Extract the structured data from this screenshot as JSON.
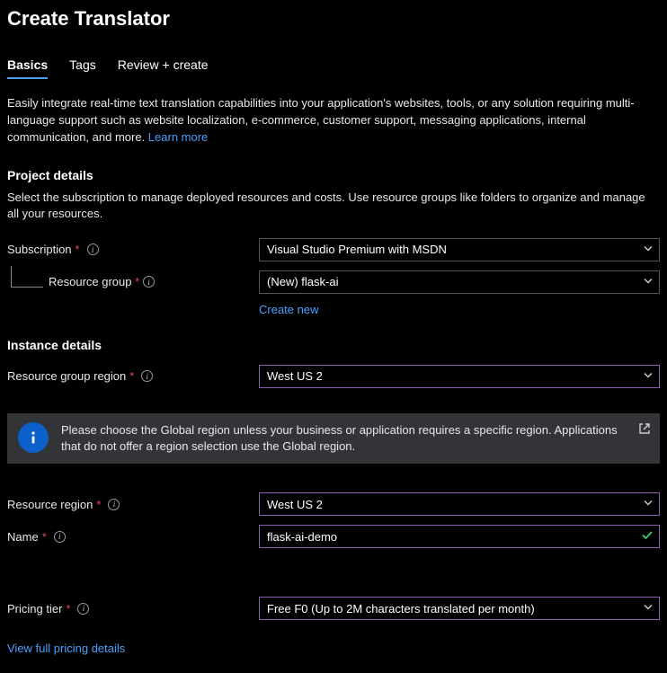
{
  "page_title": "Create Translator",
  "tabs": {
    "basics": "Basics",
    "tags": "Tags",
    "review": "Review + create"
  },
  "intro_text": "Easily integrate real-time text translation capabilities into your application's websites, tools, or any solution requiring multi-language support such as website localization, e-commerce, customer support, messaging applications, internal communication, and more. ",
  "learn_more": "Learn more",
  "project_details": {
    "title": "Project details",
    "desc": "Select the subscription to manage deployed resources and costs. Use resource groups like folders to organize and manage all your resources.",
    "subscription_label": "Subscription",
    "subscription_value": "Visual Studio Premium with MSDN",
    "resource_group_label": "Resource group",
    "resource_group_value": "(New) flask-ai",
    "create_new": "Create new"
  },
  "instance_details": {
    "title": "Instance details",
    "rg_region_label": "Resource group region",
    "rg_region_value": "West US 2",
    "banner": "Please choose the Global region unless your business or application requires a specific region. Applications that do not offer a region selection use the Global region.",
    "resource_region_label": "Resource region",
    "resource_region_value": "West US 2",
    "name_label": "Name",
    "name_value": "flask-ai-demo"
  },
  "pricing": {
    "tier_label": "Pricing tier",
    "tier_value": "Free F0 (Up to 2M characters translated per month)",
    "link": "View full pricing details"
  }
}
